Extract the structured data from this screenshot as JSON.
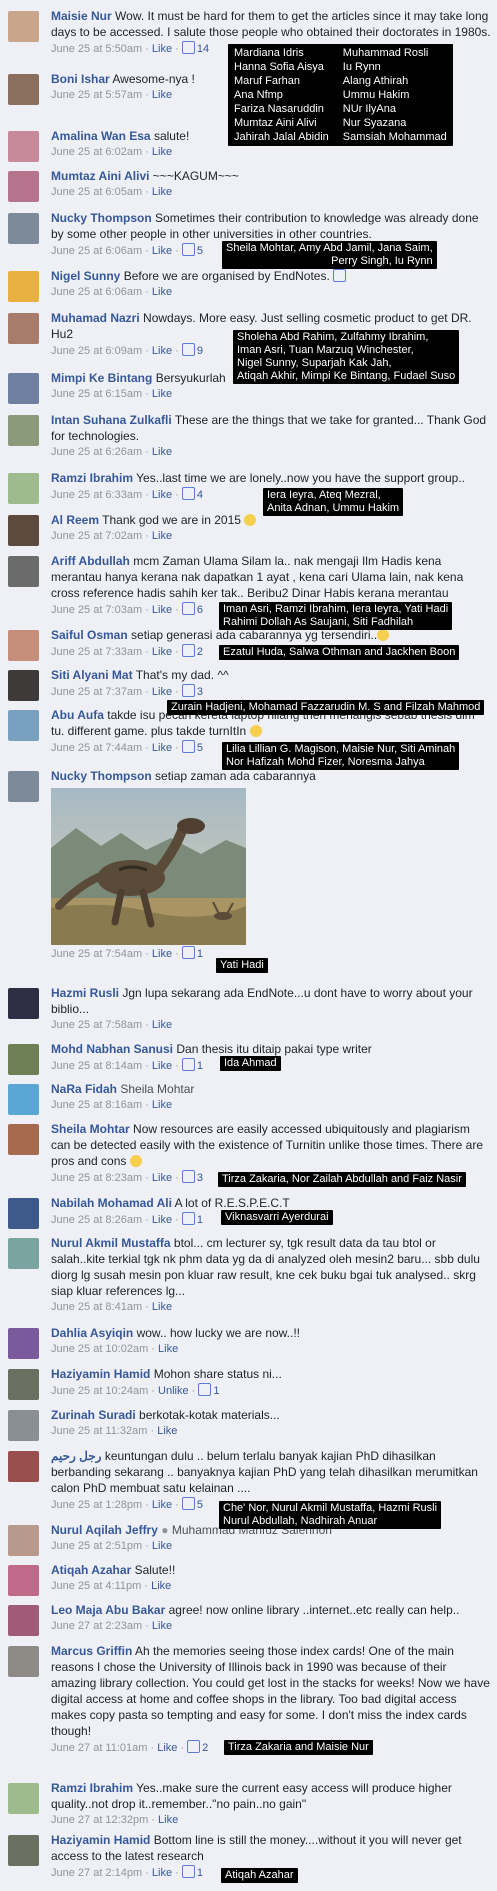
{
  "comments": [
    {
      "name": "Maisie Nur",
      "text": "Wow. It must be hard for them to get the articles since it may take long days to be accessed. I salute those people who obtained their doctorates in 1980s.",
      "time": "June 25 at 5:50am",
      "likes": "14"
    },
    {
      "name": "Boni Ishar",
      "text": "Awesome-nya !",
      "time": "June 25 at 5:57am"
    },
    {
      "name": "Amalina Wan Esa",
      "text": "salute!",
      "time": "June 25 at 6:02am"
    },
    {
      "name": "Mumtaz Aini Alivi",
      "text": "~~~KAGUM~~~",
      "time": "June 25 at 6:05am"
    },
    {
      "name": "Nucky Thompson",
      "text": "Sometimes their contribution to knowledge was already done by some other people in other universities in other countries.",
      "time": "June 25 at 6:06am",
      "likes": "5"
    },
    {
      "name": "Nigel Sunny",
      "text": "Before we are organised by EndNotes.",
      "time": "June 25 at 6:06am"
    },
    {
      "name": "Muhamad Nazri",
      "text": "Nowdays. More easy. Just selling cosmetic product to get DR. Hu2",
      "time": "June 25 at 6:09am",
      "likes": "9"
    },
    {
      "name": "Mimpi Ke Bintang",
      "text": "Bersyukurlah",
      "time": "June 25 at 6:15am"
    },
    {
      "name": "Intan Suhana Zulkafli",
      "text": "These are the things that we take for granted... Thank God for technologies.",
      "time": "June 25 at 6:26am"
    },
    {
      "name": "Ramzi Ibrahim",
      "text": "Yes..last time we are lonely..now you have the support group..",
      "time": "June 25 at 6:33am",
      "likes": "4"
    },
    {
      "name": "Al Reem",
      "text": "Thank god we are in 2015",
      "time": "June 25 at 7:02am"
    },
    {
      "name": "Ariff Abdullah",
      "text": "mcm Zaman Ulama Silam la.. nak mengaji Ilm Hadis kena merantau hanya kerana nak dapatkan 1 ayat , kena cari Ulama lain, nak kena cross reference hadis sahih ker tak.. Beribu2 Dinar Habis kerana merantau",
      "time": "June 25 at 7:03am",
      "likes": "6"
    },
    {
      "name": "Saiful Osman",
      "text": "setiap generasi ada cabarannya yg tersendiri..",
      "time": "June 25 at 7:33am",
      "likes": "2"
    },
    {
      "name": "Siti Alyani Mat",
      "text": "That's my dad. ^^",
      "time": "June 25 at 7:37am",
      "likes": "3"
    },
    {
      "name": "Abu Aufa",
      "text": "takde isu pecah kereta laptop hilang then menangis sebab thesis dlm tu. different game. plus takde turnItIn",
      "time": "June 25 at 7:44am",
      "likes": "5"
    },
    {
      "name": "Nucky Thompson",
      "text": "setiap zaman ada cabarannya",
      "time": "June 25 at 7:54am",
      "likes": "1"
    },
    {
      "name": "Hazmi Rusli",
      "text": "Jgn lupa sekarang ada EndNote...u dont have to worry about your biblio...",
      "time": "June 25 at 7:58am"
    },
    {
      "name": "Mohd Nabhan Sanusi",
      "text": "Dan thesis itu ditaip pakai type writer",
      "time": "June 25 at 8:14am",
      "likes": "1"
    },
    {
      "name": "NaRa Fidah",
      "text": "Sheila Mohtar",
      "time": "June 25 at 8:16am"
    },
    {
      "name": "Sheila Mohtar",
      "text": "Now resources are easily accessed ubiquitously and plagiarism can be detected easily with the existence of Turnitin unlike those times. There are pros and cons",
      "time": "June 25 at 8:23am",
      "likes": "3"
    },
    {
      "name": "Nabilah Mohamad Ali",
      "text": "A lot of R.E.S.P.E.C.T",
      "time": "June 25 at 8:26am",
      "likes": "1"
    },
    {
      "name": "Nurul Akmil Mustaffa",
      "text": "btol... cm lecturer sy, tgk result data da tau btol or salah..kite terkial tgk nk phm data yg da di analyzed oleh mesin2 baru... sbb dulu diorg lg susah mesin pon kluar raw result, kne cek buku bgai tuk analysed.. skrg siap kluar references lg...",
      "time": "June 25 at 8:41am"
    },
    {
      "name": "Dahlia Asyiqin",
      "text": "wow.. how lucky we are now..!!",
      "time": "June 25 at 10:02am"
    },
    {
      "name": "Haziyamin Hamid",
      "text": "Mohon share status ni...",
      "time": "June 25 at 10:24am",
      "likes": "1",
      "unlike": true
    },
    {
      "name": "Zurinah Suradi",
      "text": "berkotak-kotak materials...",
      "time": "June 25 at 11:32am"
    },
    {
      "name": "رجل رحيم",
      "text": "keuntungan dulu .. belum terlalu banyak kajian PhD dihasilkan berbanding sekarang .. banyaknya kajian PhD yang telah dihasilkan merumitkan calon PhD membuat satu kelainan ....",
      "time": "June 25 at 1:28pm",
      "likes": "5"
    },
    {
      "name": "Nurul Aqilah Jeffry",
      "text": "Muhammad Mahfuz Salehhon",
      "time": "June 25 at 2:51pm"
    },
    {
      "name": "Atiqah Azahar",
      "text": "Salute!!",
      "time": "June 25 at 4:11pm"
    },
    {
      "name": "Leo Maja Abu Bakar",
      "text": "agree! now online library ..internet..etc really can help..",
      "time": "June 27 at 2:23am"
    },
    {
      "name": "Marcus Griffin",
      "text": "Ah the memories seeing those index cards! One of the main reasons I chose the University of Illinois back in 1990 was because of their amazing library collection. You could get lost in the stacks for weeks! Now we have digital access at home and coffee shops in the library. Too bad digital access makes copy pasta so tempting and easy for some. I don't miss the index cards though!",
      "time": "June 27 at 11:01am",
      "likes": "2"
    },
    {
      "name": "Ramzi Ibrahim",
      "text": "Yes..make sure the current easy access will produce higher quality..not drop it..remember..\"no pain..no gain\"",
      "time": "June 27 at 12:32pm"
    },
    {
      "name": "Haziyamin Hamid",
      "text": "Bottom line is still the money....without it you will never get access to the latest research",
      "time": "June 27 at 2:14pm",
      "likes": "1"
    }
  ],
  "labels": {
    "like": "Like",
    "unlike": "Unlike",
    "sep": " · "
  },
  "tooltips": {
    "t1_left": [
      "Mardiana Idris",
      "Hanna Sofia Aisya",
      "Maruf Farhan",
      "Ana Nfmp",
      "Fariza Nasaruddin",
      "Mumtaz Aini Alivi",
      "Jahirah Jalal Abidin"
    ],
    "t1_right": [
      "Muhammad Rosli",
      "Iu Rynn",
      "Alang Athirah",
      "Ummu Hakim",
      "NUr IlyAna",
      "Nur Syazana",
      "Samsiah Mohammad"
    ],
    "t2": [
      "Sheila Mohtar, Amy Abd Jamil, Jana Saim,",
      "Perry Singh, Iu Rynn"
    ],
    "t3": [
      "Sholeha Abd Rahim, Zulfahmy Ibrahim,",
      "Iman Asri, Tuan Marzuq Winchester,",
      "Nigel Sunny, Suparjah Kak Jah,",
      "Atiqah Akhir, Mimpi Ke Bintang, Fudael Suso"
    ],
    "t4": [
      "Iera Ieyra, Ateq Mezral,",
      "Anita Adnan, Ummu Hakim"
    ],
    "t5": [
      "Iman Asri, Ramzi Ibrahim, Iera Ieyra, Yati Hadi",
      "Rahimi Dollah As Saujani, Siti Fadhilah"
    ],
    "t6": [
      "Ezatul Huda, Salwa Othman and Jackhen Boon"
    ],
    "t7": [
      "Zurain Hadjeni, Mohamad Fazzarudin M. S and Filzah Mahmod"
    ],
    "t8": [
      "Lilia Lillian G. Magison, Maisie Nur, Siti Aminah",
      "Nor Hafizah Mohd Fizer, Noresma Jahya"
    ],
    "t9": [
      "Yati Hadi"
    ],
    "t10": [
      "Ida Ahmad"
    ],
    "t11": [
      "Tirza Zakaria, Nor Zailah Abdullah and Faiz Nasir"
    ],
    "t12": [
      "Viknasvarri Ayerdurai"
    ],
    "t13": [
      "Che' Nor, Nurul Akmil Mustaffa, Hazmi Rusli",
      "Nurul Abdullah, Nadhirah Anuar"
    ],
    "t14": [
      "Tirza Zakaria and Maisie Nur"
    ],
    "t15": [
      "Atiqah Azahar"
    ]
  },
  "colors": {
    "link": "#365899",
    "meta": "#90949c",
    "tooltip_bg": "#000000",
    "page_bg": "#eef0f5"
  }
}
